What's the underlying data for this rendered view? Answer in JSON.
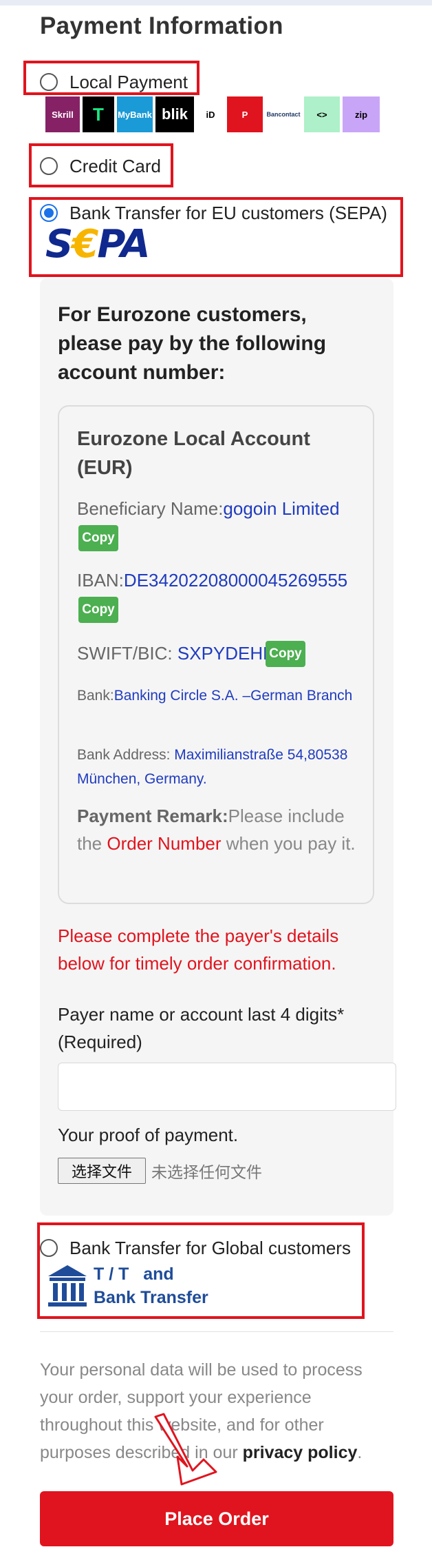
{
  "section": {
    "title": "Payment Information"
  },
  "options": {
    "local": {
      "label": "Local Payment"
    },
    "credit": {
      "label": "Credit Card"
    },
    "sepa": {
      "label": "Bank Transfer for EU customers (SEPA)"
    },
    "global": {
      "label": "Bank Transfer for Global customers"
    }
  },
  "local_logos": [
    {
      "name": "Skrill",
      "text": "Skrill",
      "bg": "#862165",
      "fg": "#ffffff"
    },
    {
      "name": "TWINT",
      "text": "T",
      "bg": "#000000",
      "fg": "#1ce783"
    },
    {
      "name": "MyBank",
      "text": "MyBank",
      "bg": "#1a9ad6",
      "fg": "#ffffff"
    },
    {
      "name": "BLIK",
      "text": "blik",
      "bg": "#000000",
      "fg": "#ffffff"
    },
    {
      "name": "iDEAL",
      "text": "iD",
      "bg": "#ffffff",
      "fg": "#000000"
    },
    {
      "name": "Przelewy",
      "text": "P",
      "bg": "#e0141e",
      "fg": "#ffffff"
    },
    {
      "name": "Bancontact",
      "text": "Bancontact",
      "bg": "#ffffff",
      "fg": "#1e3764"
    },
    {
      "name": "Trustly",
      "text": "<>",
      "bg": "#aef0c9",
      "fg": "#000000"
    },
    {
      "name": "Zip",
      "text": "zip",
      "bg": "#c9a5f7",
      "fg": "#000000"
    }
  ],
  "sepa_logo": {
    "prefix": "S",
    "euro": "€",
    "suffix": "PA"
  },
  "sepa_panel": {
    "heading": "For Eurozone customers, please pay by the following account number:",
    "account_title": "Eurozone Local Account (EUR)",
    "beneficiary_label": "Beneficiary Name:",
    "beneficiary_value": "gogoin Limited",
    "iban_label": "IBAN:",
    "iban_value": "DE34202208000045269555",
    "swift_label": "SWIFT/BIC: ",
    "swift_value": "SXPYDEHH",
    "bank_label": "Bank:",
    "bank_value": "Banking Circle S.A. –German Branch",
    "address_label": "Bank Address: ",
    "address_value": "Maximilianstraße 54,80538 München, Germany.",
    "remark_label": "Payment Remark:",
    "remark_text_1": "Please include the ",
    "remark_highlight": "Order Number",
    "remark_text_2": " when you pay it.",
    "copy_label": "Copy",
    "notice": "Please complete the payer's details below for timely order confirmation.",
    "payer_label": "Payer name or account last 4 digits* (Required)",
    "payer_value": "",
    "proof_label": "Your proof of payment.",
    "file_button": "选择文件",
    "file_status": "未选择任何文件"
  },
  "tt_logo": {
    "line1": "T / T   and",
    "line2": "Bank Transfer"
  },
  "privacy": {
    "text": "Your personal data will be used to process your order, support your experience throughout this website, and for other purposes described in our ",
    "link": "privacy policy",
    "end": "."
  },
  "place_order": {
    "label": "Place Order"
  },
  "colors": {
    "accent_red": "#e0141e",
    "link_blue": "#1f3bbf",
    "copy_green": "#4caf50",
    "radio_blue": "#1a73e8"
  }
}
